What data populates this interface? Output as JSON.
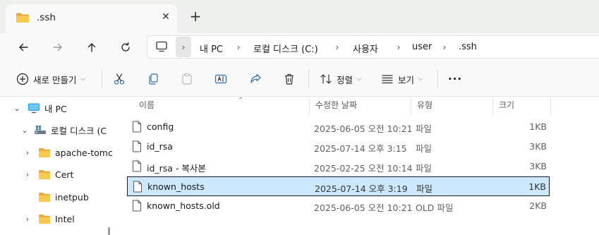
{
  "tab": {
    "title": ".ssh",
    "close_glyph": "✕",
    "new_tab_glyph": "+"
  },
  "nav": {
    "back": "back-arrow-icon",
    "forward": "forward-arrow-icon",
    "up": "up-arrow-icon",
    "refresh": "refresh-icon"
  },
  "address": {
    "separator": "›",
    "crumbs": [
      "내 PC",
      "로컬 디스크 (C:)",
      "사용자",
      "user",
      ".ssh"
    ]
  },
  "commands": {
    "new": "새로 만들기",
    "sort": "정렬",
    "view": "보기",
    "more": "···"
  },
  "sidebar": {
    "items": [
      {
        "label": "내 PC",
        "icon": "monitor-icon",
        "chevron": "⌄"
      },
      {
        "label": "로컬 디스크 (C",
        "icon": "drive-icon",
        "chevron": "⌄"
      },
      {
        "label": "apache-tomc",
        "icon": "folder-icon",
        "chevron": "›"
      },
      {
        "label": "Cert",
        "icon": "folder-icon",
        "chevron": "›"
      },
      {
        "label": "inetpub",
        "icon": "folder-icon",
        "chevron": ""
      },
      {
        "label": "Intel",
        "icon": "folder-icon",
        "chevron": "›"
      }
    ]
  },
  "columns": {
    "name": "이름",
    "date": "수정한 날짜",
    "type": "유형",
    "size": "크기"
  },
  "files": [
    {
      "name": "config",
      "date": "2025-06-05 오전 10:21",
      "type": "파일",
      "size": "1KB",
      "selected": false
    },
    {
      "name": "id_rsa",
      "date": "2025-07-14 오후 3:15",
      "type": "파일",
      "size": "3KB",
      "selected": false
    },
    {
      "name": "id_rsa - 복사본",
      "date": "2025-02-25 오전 10:14",
      "type": "파일",
      "size": "3KB",
      "selected": false
    },
    {
      "name": "known_hosts",
      "date": "2025-07-14 오후 3:19",
      "type": "파일",
      "size": "1KB",
      "selected": true
    },
    {
      "name": "known_hosts.old",
      "date": "2025-06-05 오전 10:21",
      "type": "OLD 파일",
      "size": "2KB",
      "selected": false
    }
  ],
  "colors": {
    "accent": "#005fb8",
    "selection": "#cce8ff",
    "folder": "#f5c242"
  }
}
